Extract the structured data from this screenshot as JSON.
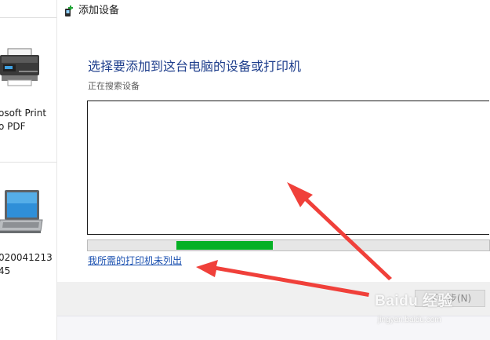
{
  "background_window": {
    "devices": [
      {
        "label": "osoft Print\no PDF",
        "icon": "printer-icon"
      },
      {
        "label": "020041213\n45",
        "icon": "laptop-icon"
      }
    ]
  },
  "dialog": {
    "title": "添加设备",
    "title_icon": "add-device-icon",
    "heading": "选择要添加到这台电脑的设备或打印机",
    "status": "正在搜索设备",
    "device_list": {
      "items": []
    },
    "progress": {
      "fill_start": 0.22,
      "fill_end": 0.46,
      "color": "#06b025"
    },
    "missing_printer_link": "我所需的打印机未列出",
    "next_button": "下一步(N)"
  },
  "annotations": {
    "arrow_color": "#f0403a",
    "arrows": [
      "arrow-to-device-list",
      "arrow-to-missing-printer-link"
    ]
  },
  "watermark": {
    "brand": "Baidu 经验",
    "url": "jingyan.baidu.com"
  }
}
